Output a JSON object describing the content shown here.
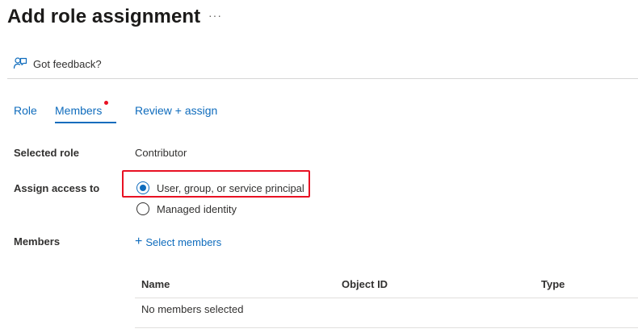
{
  "header": {
    "title": "Add role assignment",
    "more_label": "···"
  },
  "feedback": {
    "label": "Got feedback?",
    "icon": "feedback-icon"
  },
  "tabs": [
    {
      "label": "Role",
      "active": false
    },
    {
      "label": "Members",
      "active": true,
      "has_indicator": true
    },
    {
      "label": "Review + assign",
      "active": false
    }
  ],
  "form": {
    "selected_role": {
      "label": "Selected role",
      "value": "Contributor"
    },
    "assign_access_to": {
      "label": "Assign access to",
      "options": [
        {
          "label": "User, group, or service principal",
          "selected": true
        },
        {
          "label": "Managed identity",
          "selected": false
        }
      ]
    },
    "members": {
      "label": "Members",
      "select_label": "Select members",
      "select_icon": "plus-icon"
    }
  },
  "members_table": {
    "columns": [
      "Name",
      "Object ID",
      "Type"
    ],
    "empty_text": "No members selected"
  },
  "colors": {
    "accent": "#0f6cbd",
    "highlight_border": "#e81123",
    "indicator_dot": "#e81123"
  }
}
